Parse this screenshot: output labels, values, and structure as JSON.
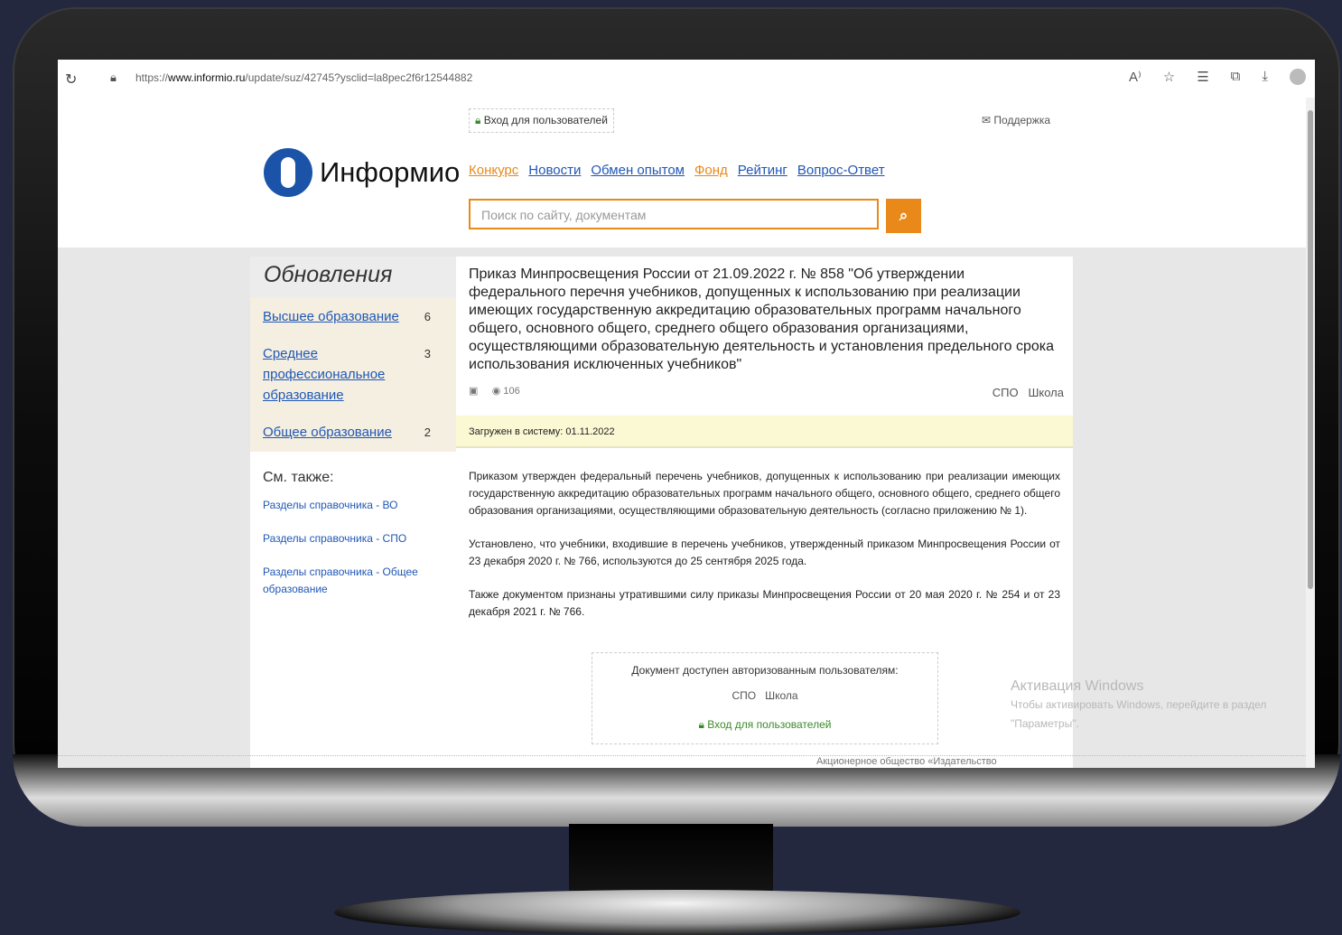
{
  "browser": {
    "url_prefix": "https://",
    "url_domain": "www.informio.ru",
    "url_path": "/update/suz/42745?ysclid=la8pec2f6r12544882"
  },
  "header": {
    "login": "Вход для пользователей",
    "support": "Поддержка",
    "logo_text": "Информио",
    "nav": [
      "Конкурс",
      "Новости",
      "Обмен опытом",
      "Фонд",
      "Рейтинг",
      "Вопрос-Ответ"
    ],
    "search_placeholder": "Поиск по сайту, документам"
  },
  "sidebar": {
    "title": "Обновления",
    "items": [
      {
        "label": "Высшее образование",
        "count": "6"
      },
      {
        "label": "Среднее профессиональное образование",
        "count": "3"
      },
      {
        "label": "Общее образование",
        "count": "2"
      }
    ],
    "see_also_title": "См. также:",
    "see_also": [
      "Разделы справочника - ВО",
      "Разделы справочника - СПО",
      "Разделы справочника - Общее образование"
    ]
  },
  "document": {
    "title": "Приказ Минпросвещения России от 21.09.2022 г. № 858 \"Об утверждении федерального перечня учебников, допущенных к использованию при реализации имеющих государственную аккредитацию образовательных программ начального общего, основного общего, среднего общего образования организациями, осуществляющими образовательную деятельность и установления предельного срока использования исключенных учебников\"",
    "views": "106",
    "tag1": "СПО",
    "tag2": "Школа",
    "loaded": "Загружен в систему: 01.11.2022",
    "p1": "Приказом утвержден федеральный перечень учебников, допущенных к использованию при реализации имеющих государственную аккредитацию образовательных программ начального общего, основного общего, среднего общего образования организациями, осуществляющими образовательную деятельность (согласно приложению № 1).",
    "p2": "Установлено, что учебники, входившие в перечень учебников, утвержденный приказом Минпросвещения России от 23 декабря 2020 г. № 766, используются до 25 сентября 2025 года.",
    "p3": "Также документом признаны утратившими силу приказы Минпросвещения России от 20 мая 2020 г. № 254 и от 23 декабря 2021 г. № 766.",
    "auth_text": "Документ доступен авторизованным пользователям:",
    "auth_tags": "СПО   Школа",
    "auth_login": "Вход для пользователей"
  },
  "watermark": {
    "line1": "Активация Windows",
    "line2": "Чтобы активировать Windows, перейдите в раздел",
    "line3": "\"Параметры\"."
  },
  "footer": {
    "text": "Акционерное общество «Издательство"
  }
}
